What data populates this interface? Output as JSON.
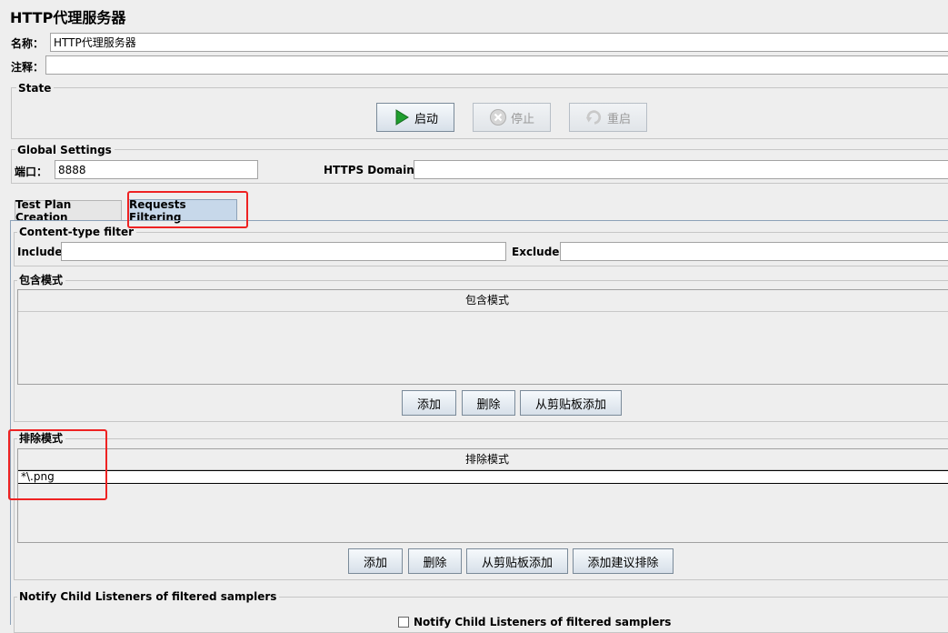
{
  "window": {
    "title": "HTTP代理服务器"
  },
  "name_field": {
    "label": "名称：",
    "value": "HTTP代理服务器"
  },
  "comment_field": {
    "label": "注释：",
    "value": ""
  },
  "state": {
    "legend": "State",
    "start_label": "启动",
    "stop_label": "停止",
    "restart_label": "重启"
  },
  "global": {
    "legend": "Global Settings",
    "port_label": "端口：",
    "port_value": "8888",
    "https_label": "HTTPS Domains:",
    "https_value": ""
  },
  "tabs": [
    {
      "label": "Test Plan Creation",
      "active": false
    },
    {
      "label": "Requests Filtering",
      "active": true
    }
  ],
  "content_type": {
    "legend": "Content-type filter",
    "include_label": "Include:",
    "include_value": "",
    "exclude_label": "Exclude:",
    "exclude_value": ""
  },
  "include_patterns": {
    "legend": "包含模式",
    "column_header": "包含模式",
    "rows": [],
    "add_label": "添加",
    "delete_label": "删除",
    "paste_label": "从剪贴板添加"
  },
  "exclude_patterns": {
    "legend": "排除模式",
    "column_header": "排除模式",
    "rows": [
      "*\\.png"
    ],
    "add_label": "添加",
    "delete_label": "删除",
    "paste_label": "从剪贴板添加",
    "suggest_label": "添加建议排除"
  },
  "notify": {
    "legend": "Notify Child Listeners of filtered samplers",
    "checkbox_label": "Notify Child Listeners of filtered samplers"
  },
  "colors": {
    "highlight": "#ee2222",
    "play": "#1f9e2f",
    "background": "#eeeeee"
  }
}
